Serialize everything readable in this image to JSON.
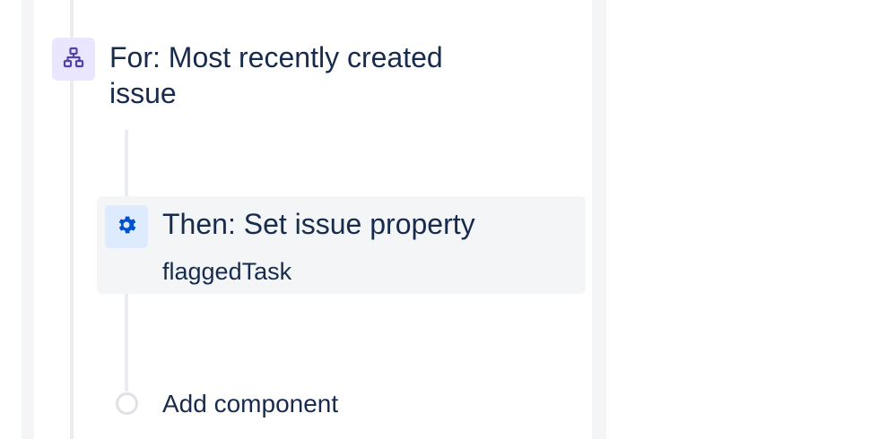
{
  "colors": {
    "text": "#172b4d",
    "branch_icon_bg": "#eae6ff",
    "branch_icon_fg": "#5243aa",
    "action_icon_bg": "#deebff",
    "action_icon_fg": "#0052cc",
    "card_bg": "#f4f5f7",
    "connector": "#ebecf0"
  },
  "branch": {
    "icon": "branch-hierarchy-icon",
    "title": "For: Most recently created issue"
  },
  "action": {
    "icon": "gear-icon",
    "title": "Then: Set issue property",
    "subtitle": "flaggedTask"
  },
  "add_component": {
    "icon": "empty-circle-icon",
    "label": "Add component"
  }
}
